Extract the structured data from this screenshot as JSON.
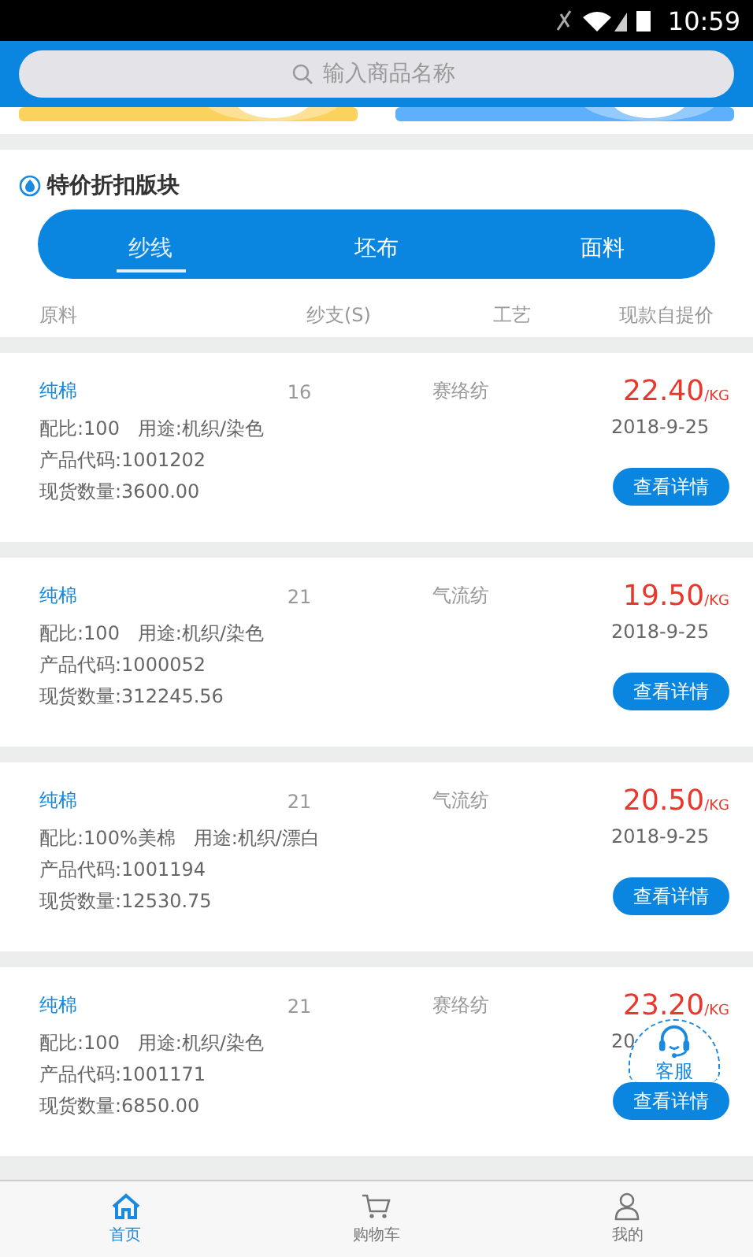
{
  "status_bar": {
    "time": "10:59"
  },
  "search": {
    "placeholder": "输入商品名称"
  },
  "section": {
    "title": "特价折扣版块"
  },
  "tabs": [
    {
      "label": "纱线",
      "selected": true
    },
    {
      "label": "坯布",
      "selected": false
    },
    {
      "label": "面料",
      "selected": false
    }
  ],
  "columns": [
    "原料",
    "纱支(S)",
    "工艺",
    "现款自提价"
  ],
  "products": [
    {
      "material": "纯棉",
      "count": "16",
      "process": "赛络纺",
      "price": "22.40",
      "unit": "/KG",
      "ratio": "配比:100",
      "usage": "用途:机织/染色",
      "code": "产品代码:1001202",
      "stock": "现货数量:3600.00",
      "date": "2018-9-25",
      "button": "查看详情"
    },
    {
      "material": "纯棉",
      "count": "21",
      "process": "气流纺",
      "price": "19.50",
      "unit": "/KG",
      "ratio": "配比:100",
      "usage": "用途:机织/染色",
      "code": "产品代码:1000052",
      "stock": "现货数量:312245.56",
      "date": "2018-9-25",
      "button": "查看详情"
    },
    {
      "material": "纯棉",
      "count": "21",
      "process": "气流纺",
      "price": "20.50",
      "unit": "/KG",
      "ratio": "配比:100%美棉",
      "usage": "用途:机织/漂白",
      "code": "产品代码:1001194",
      "stock": "现货数量:12530.75",
      "date": "2018-9-25",
      "button": "查看详情"
    },
    {
      "material": "纯棉",
      "count": "21",
      "process": "赛络纺",
      "price": "23.20",
      "unit": "/KG",
      "ratio": "配比:100",
      "usage": "用途:机织/染色",
      "code": "产品代码:1001171",
      "stock": "现货数量:6850.00",
      "date": "20",
      "button": "查看详情"
    }
  ],
  "support_button": {
    "label": "客服"
  },
  "bottom_nav": [
    {
      "label": "首页",
      "kind": "home",
      "selected": true
    },
    {
      "label": "购物车",
      "kind": "cart",
      "selected": false
    },
    {
      "label": "我的",
      "kind": "user",
      "selected": false
    }
  ]
}
